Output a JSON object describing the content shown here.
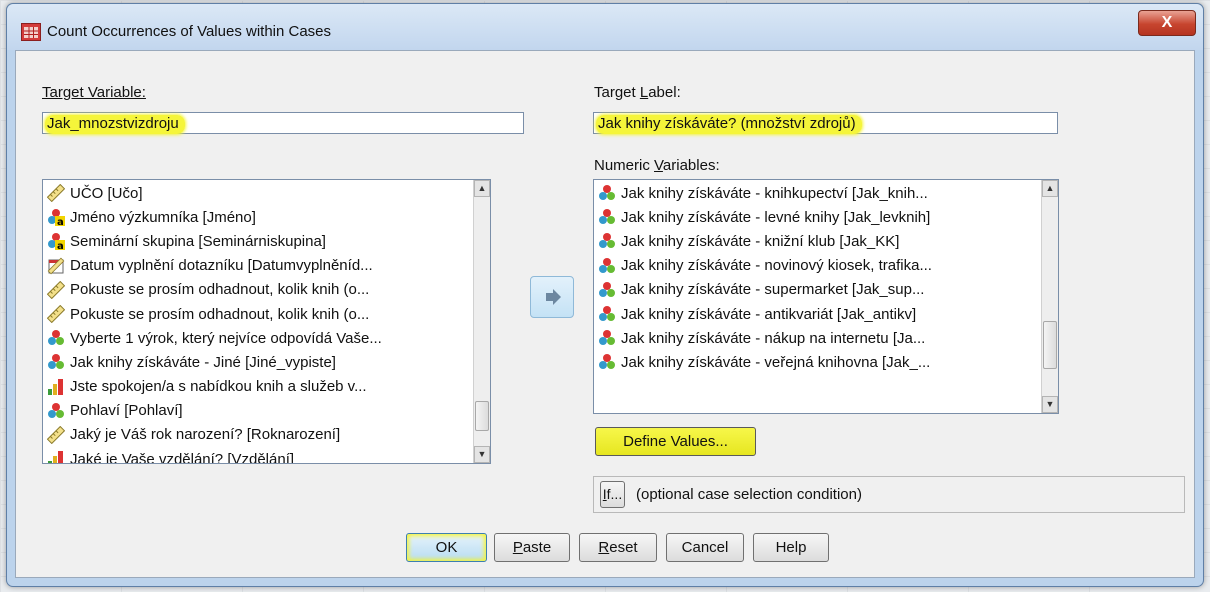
{
  "window": {
    "title": "Count Occurrences of Values within Cases",
    "close_label": "X"
  },
  "target_variable": {
    "label": "Target Variable:",
    "value": "Jak_mnozstvizdroju"
  },
  "target_label": {
    "label": "Target Label:",
    "value": "Jak knihy získáváte? (množství zdrojů)"
  },
  "numeric_variables_label": "Numeric Variables:",
  "source_list": {
    "items": [
      {
        "label": "UČO [Učo]",
        "icon": "scale-ruler-icon"
      },
      {
        "label": "Jméno výzkumníka [Jméno]",
        "icon": "nominal-string-icon"
      },
      {
        "label": "Seminární skupina [Seminárniskupina]",
        "icon": "nominal-string-icon"
      },
      {
        "label": "Datum vyplnění dotazníku [Datumvyplněníd...",
        "icon": "date-icon"
      },
      {
        "label": "Pokuste se prosím odhadnout, kolik knih (o...",
        "icon": "scale-ruler-icon"
      },
      {
        "label": "Pokuste se prosím odhadnout, kolik knih (o...",
        "icon": "scale-ruler-icon"
      },
      {
        "label": "Vyberte 1 výrok, který nejvíce odpovídá Vaše...",
        "icon": "nominal-icon"
      },
      {
        "label": "Jak knihy získáváte - Jiné [Jiné_vypiste]",
        "icon": "nominal-icon"
      },
      {
        "label": "Jste spokojen/a s nabídkou knih a služeb v...",
        "icon": "ordinal-icon"
      },
      {
        "label": "Pohlaví [Pohlaví]",
        "icon": "nominal-icon"
      },
      {
        "label": "Jaký je Váš rok narození? [Roknarození]",
        "icon": "scale-ruler-icon"
      },
      {
        "label": "Jaké je Vaše vzdělání? [Vzdělání]",
        "icon": "ordinal-icon"
      }
    ],
    "scroll_fraction": 0.93
  },
  "numeric_list": {
    "items": [
      {
        "label": "Jak knihy získáváte - knihkupectví [Jak_knih...",
        "icon": "nominal-icon"
      },
      {
        "label": "Jak knihy získáváte - levné knihy [Jak_levknih]",
        "icon": "nominal-icon"
      },
      {
        "label": "Jak knihy získáváte - knižní klub [Jak_KK]",
        "icon": "nominal-icon"
      },
      {
        "label": "Jak knihy získáváte - novinový kiosek, trafika...",
        "icon": "nominal-icon"
      },
      {
        "label": "Jak knihy získáváte - supermarket [Jak_sup...",
        "icon": "nominal-icon"
      },
      {
        "label": "Jak knihy získáváte - antikvariát [Jak_antikv]",
        "icon": "nominal-icon"
      },
      {
        "label": "Jak knihy získáváte - nákup na internetu [Ja...",
        "icon": "nominal-icon"
      },
      {
        "label": "Jak knihy získáváte - veřejná knihovna [Jak_...",
        "icon": "nominal-icon"
      }
    ],
    "scroll_fraction": 0.82
  },
  "buttons": {
    "define_values": "Define Values...",
    "if": "If...",
    "ok": "OK",
    "paste": "Paste",
    "reset": "Reset",
    "cancel": "Cancel",
    "help": "Help"
  },
  "condition_text": "(optional case selection condition)",
  "colors": {
    "highlight": "#f5f53a",
    "accent": "#3c7fb1"
  }
}
